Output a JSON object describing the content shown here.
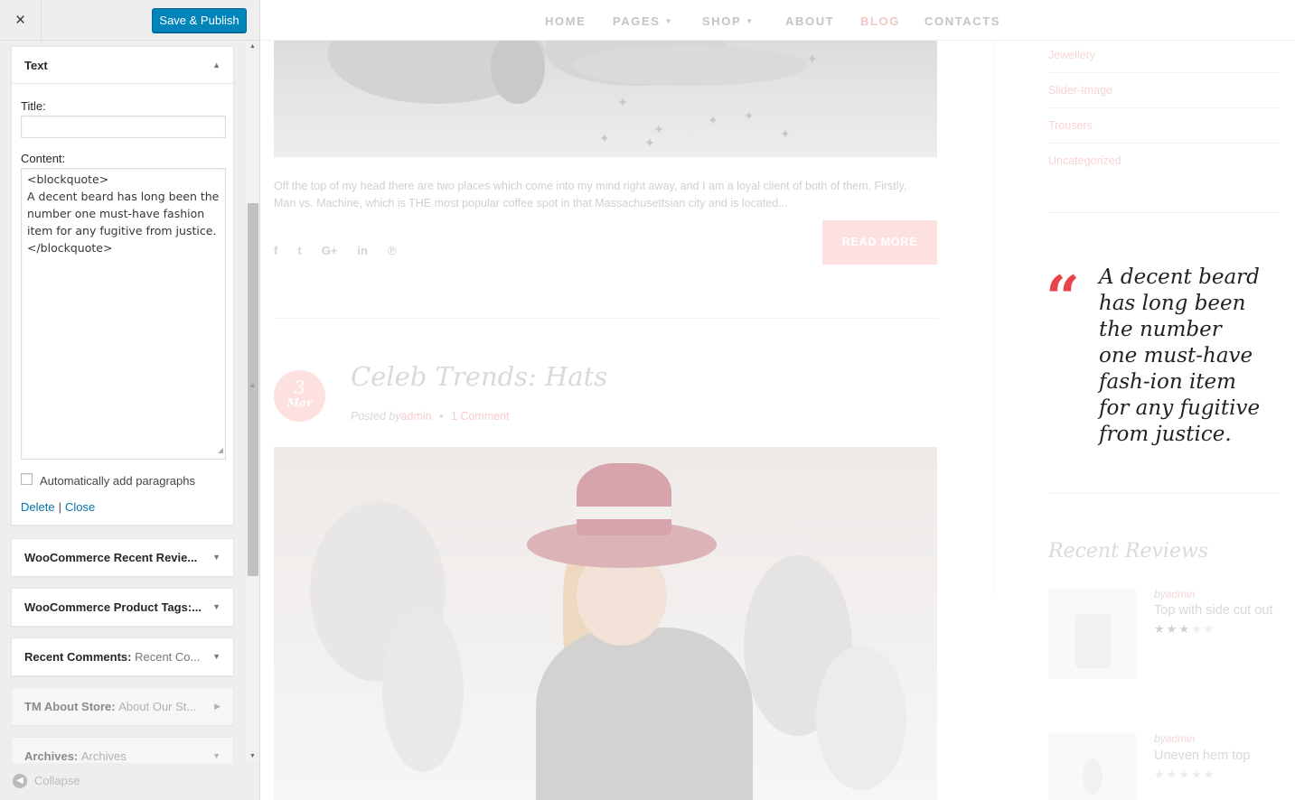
{
  "sidebar": {
    "close_label": "×",
    "save_label": "Save & Publish",
    "open_widget": {
      "title": "Text",
      "title_field_label": "Title:",
      "title_field_value": "",
      "content_label": "Content:",
      "content_value": "<blockquote>\nA decent beard has long been the number one must-have fashion item for any fugitive from justice.\n</blockquote>",
      "autop_label": "Automatically add paragraphs",
      "autop_checked": false,
      "delete_label": "Delete",
      "close_label": "Close"
    },
    "widgets": [
      {
        "name": "WooCommerce Recent Revie...",
        "sub": ""
      },
      {
        "name": "WooCommerce Product Tags:...",
        "sub": ""
      },
      {
        "name": "Recent Comments:",
        "sub": "Recent Co..."
      },
      {
        "name": "TM About Store:",
        "sub": "About Our St..."
      },
      {
        "name": "Archives:",
        "sub": "Archives"
      }
    ],
    "collapse_label": "Collapse"
  },
  "nav": {
    "items": [
      "HOME",
      "PAGES",
      "SHOP",
      "ABOUT",
      "BLOG",
      "CONTACTS"
    ],
    "active": "BLOG"
  },
  "post1": {
    "excerpt": "Off the top of my head there are two places which come into my mind right away, and I am a loyal client of both of them. Firstly, Man vs. Machine, which is THE most popular coffee spot in that Massachusettsian city and is located...",
    "read_more": "READ MORE",
    "share_icons": [
      "facebook-icon",
      "twitter-icon",
      "google-plus-icon",
      "linkedin-icon",
      "pinterest-icon"
    ]
  },
  "post2": {
    "day": "3",
    "month": "Mar",
    "title": "Celeb Trends: Hats",
    "posted_by": "Posted by",
    "author": "admin",
    "bullet": "•",
    "comments": "1 Comment"
  },
  "categories": [
    "Jewellery",
    "Slider-Image",
    "Trousers",
    "Uncategorized"
  ],
  "quote": {
    "mark": "“",
    "text": "A decent beard has long been the number one must-have fash-ion item for any fugitive from justice."
  },
  "recent_reviews": {
    "title": "Recent Reviews",
    "items": [
      {
        "by": "by",
        "author": "admin",
        "name": "Top with side cut out",
        "rating": 3,
        "max": 5
      },
      {
        "by": "by",
        "author": "admin",
        "name": "Uneven hem top",
        "rating": 0,
        "max": 5
      }
    ]
  },
  "colors": {
    "accent_blue": "#0085ba",
    "link_blue": "#0073aa",
    "quote_red": "#e8434b",
    "faded_pink": "#fde0e0"
  }
}
